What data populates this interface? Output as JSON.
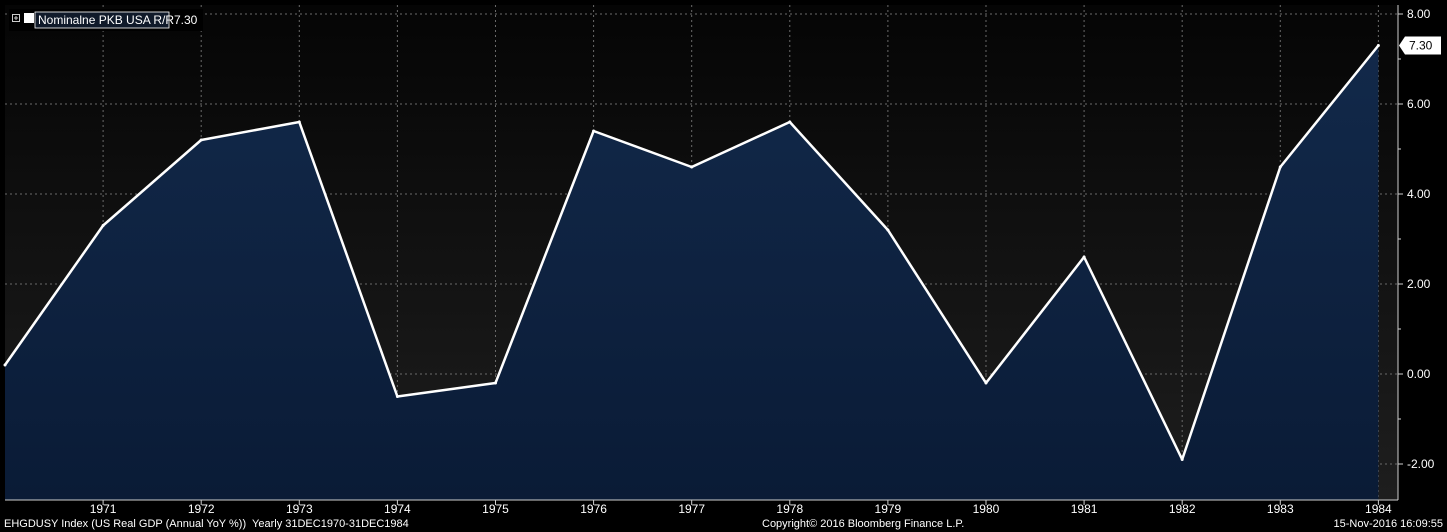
{
  "chart_data": {
    "type": "area",
    "x": [
      1970,
      1971,
      1972,
      1973,
      1974,
      1975,
      1976,
      1977,
      1978,
      1979,
      1980,
      1981,
      1982,
      1983,
      1984
    ],
    "series": [
      {
        "name": "Nominalne PKB USA R/R",
        "values": [
          0.2,
          3.3,
          5.2,
          5.6,
          -0.5,
          -0.2,
          5.4,
          4.6,
          5.6,
          3.2,
          -0.2,
          2.6,
          -1.9,
          4.6,
          7.3
        ],
        "last_value_label": "7.30",
        "line_color": "#ffffff",
        "fill_top_color": "#12294a",
        "fill_bottom_color": "#0a1b36"
      }
    ],
    "xlim": [
      1970,
      1984.2
    ],
    "ylim": [
      -2.8,
      8.2
    ],
    "x_ticks": [
      "1971",
      "1972",
      "1973",
      "1974",
      "1975",
      "1976",
      "1977",
      "1978",
      "1979",
      "1980",
      "1981",
      "1982",
      "1983",
      "1984"
    ],
    "y_ticks": [
      {
        "value": 8,
        "label": "8.00"
      },
      {
        "value": 6,
        "label": "6.00"
      },
      {
        "value": 4,
        "label": "4.00"
      },
      {
        "value": 2,
        "label": "2.00"
      },
      {
        "value": 0,
        "label": "0.00"
      },
      {
        "value": -2,
        "label": "-2.00"
      }
    ],
    "y_axis_side": "right",
    "grid": true,
    "legend_position": "top-left",
    "legend_value": "7.30",
    "background_top_color": "#050505",
    "background_bottom_color": "#1e1e1e",
    "grid_color": "#6a6a6a"
  },
  "footer": {
    "left": "EHGDUSY Index (US Real GDP (Annual YoY %))  Yearly 31DEC1970-31DEC1984",
    "center": "Copyright© 2016 Bloomberg Finance L.P.",
    "right": "15-Nov-2016 16:09:55"
  }
}
